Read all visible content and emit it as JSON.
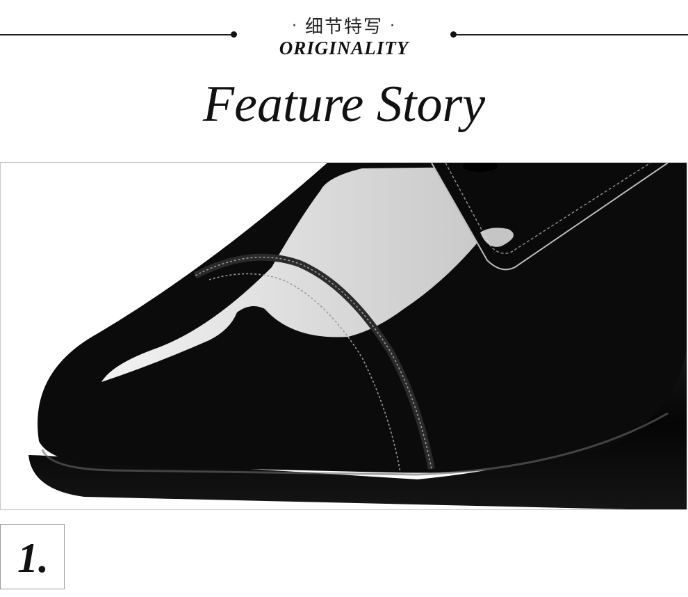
{
  "header": {
    "cn_title": "细节特写",
    "separator": "·",
    "en_subtitle": "ORIGINALITY",
    "headline": "Feature Story"
  },
  "photo": {
    "subject": "black patent leather shoe toe close-up"
  },
  "section": {
    "number": "1."
  },
  "colors": {
    "background": "#ffffff",
    "text": "#111111",
    "leather": "#0b0b0b"
  }
}
